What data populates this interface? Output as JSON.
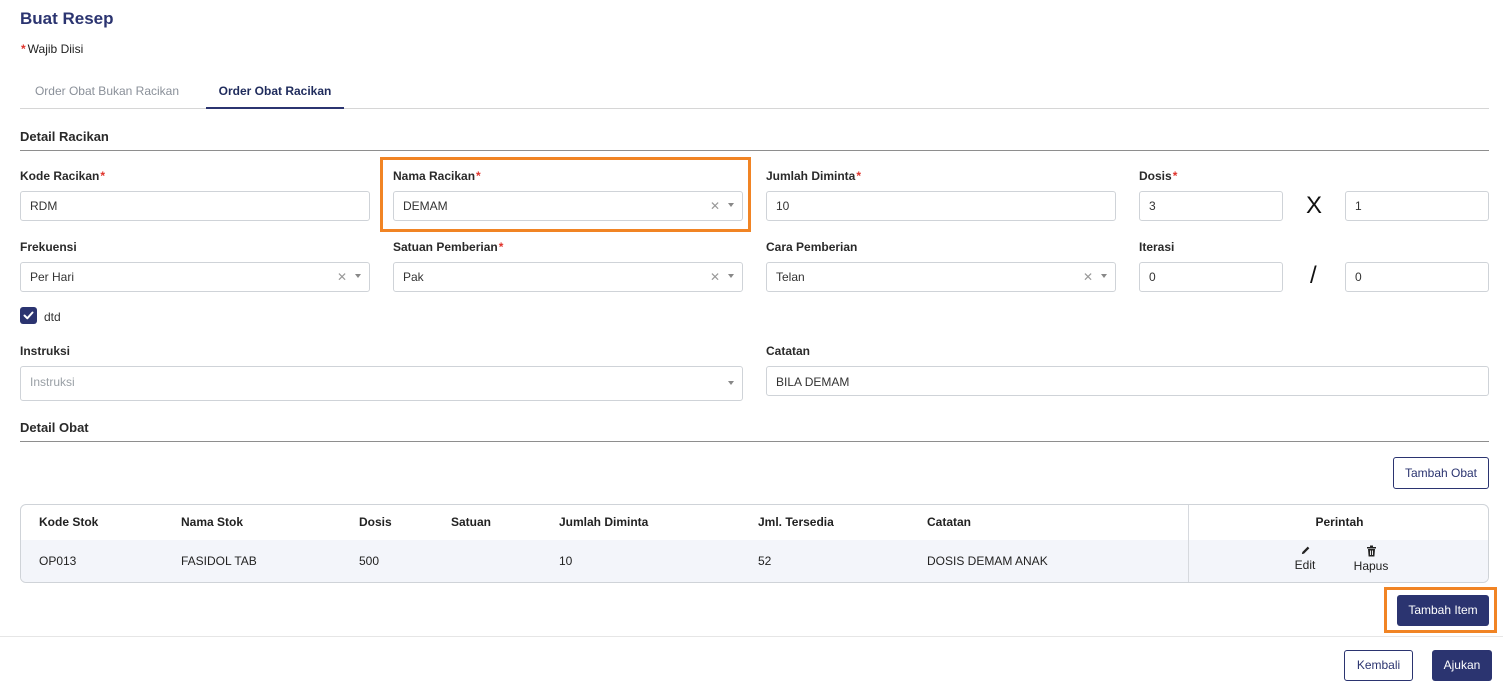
{
  "page": {
    "title": "Buat Resep",
    "required_note": "Wajib Diisi"
  },
  "tabs": [
    {
      "label": "Order Obat Bukan Racikan",
      "active": false
    },
    {
      "label": "Order Obat Racikan",
      "active": true
    }
  ],
  "detail_racikan": {
    "section_title": "Detail Racikan",
    "kode_racikan": {
      "label": "Kode Racikan",
      "value": "RDM"
    },
    "nama_racikan": {
      "label": "Nama Racikan",
      "value": "DEMAM"
    },
    "jumlah_diminta": {
      "label": "Jumlah Diminta",
      "value": "10"
    },
    "dosis": {
      "label": "Dosis",
      "value_left": "3",
      "operator": "X",
      "value_right": "1"
    },
    "frekuensi": {
      "label": "Frekuensi",
      "value": "Per Hari"
    },
    "satuan_pemberian": {
      "label": "Satuan Pemberian",
      "value": "Pak"
    },
    "cara_pemberian": {
      "label": "Cara Pemberian",
      "value": "Telan"
    },
    "iterasi": {
      "label": "Iterasi",
      "value_left": "0",
      "operator": "/",
      "value_right": "0"
    },
    "dtd": {
      "label": "dtd",
      "checked": true
    },
    "instruksi": {
      "label": "Instruksi",
      "placeholder": "Instruksi"
    },
    "catatan": {
      "label": "Catatan",
      "value": "BILA DEMAM"
    }
  },
  "detail_obat": {
    "section_title": "Detail Obat",
    "add_button": "Tambah Obat",
    "columns": [
      "Kode Stok",
      "Nama Stok",
      "Dosis",
      "Satuan",
      "Jumlah Diminta",
      "Jml. Tersedia",
      "Catatan",
      "Perintah"
    ],
    "rows": [
      {
        "kode_stok": "OP013",
        "nama_stok": "FASIDOL TAB",
        "dosis": "500",
        "satuan": "",
        "jumlah_diminta": "10",
        "jml_tersedia": "52",
        "catatan": "DOSIS DEMAM ANAK"
      }
    ],
    "actions": {
      "edit": "Edit",
      "hapus": "Hapus"
    },
    "add_item_button": "Tambah Item"
  },
  "footer": {
    "back_button": "Kembali",
    "submit_button": "Ajukan"
  },
  "colors": {
    "primary": "#2b3470",
    "highlight": "#f18424",
    "required": "#e0332b"
  }
}
